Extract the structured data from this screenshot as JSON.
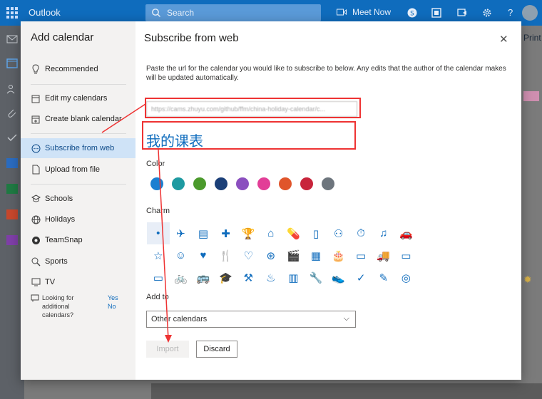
{
  "app": {
    "title": "Outlook",
    "search_placeholder": "Search",
    "meet_now": "Meet Now",
    "accent": "#0f6cbd"
  },
  "background": {
    "print_label": "Print"
  },
  "dialog": {
    "left_title": "Add calendar",
    "nav_items": [
      {
        "label": "Recommended",
        "icon": "lightbulb-icon"
      },
      {
        "label": "Edit my calendars",
        "icon": "edit-calendar-icon"
      },
      {
        "label": "Create blank calendar",
        "icon": "calendar-add-icon"
      },
      {
        "label": "Subscribe from web",
        "icon": "web-subscribe-icon",
        "active": true
      },
      {
        "label": "Upload from file",
        "icon": "upload-file-icon"
      },
      {
        "label": "Schools",
        "icon": "school-icon"
      },
      {
        "label": "Holidays",
        "icon": "globe-icon"
      },
      {
        "label": "TeamSnap",
        "icon": "teamsnap-icon"
      },
      {
        "label": "Sports",
        "icon": "sports-icon"
      },
      {
        "label": "TV",
        "icon": "tv-icon"
      }
    ],
    "looking_for": "Looking for additional calendars?",
    "yes": "Yes",
    "no": "No",
    "right_title": "Subscribe from web",
    "description": "Paste the url for the calendar you would like to subscribe to below. Any edits that the author of the calendar makes will be updated automatically.",
    "url_value": "https://cams.zhuyu.com/github/ffm/china-holiday-calendar/c...",
    "calendar_name": "我的课表",
    "color_label": "Color",
    "colors": [
      "#1a7fd1",
      "#1e9aa1",
      "#4b9a2c",
      "#1b3f78",
      "#8b4fbf",
      "#e23e97",
      "#e0552b",
      "#c8243b",
      "#6d757d"
    ],
    "charm_label": "Charm",
    "charms": [
      "•",
      "✈",
      "▤",
      "✚",
      "🏆",
      "⌂",
      "💊",
      "▯",
      "⚇",
      "⏱",
      "♫",
      "🚗",
      "☆",
      "☺",
      "♥",
      "🍴",
      "♡",
      "⊛",
      "🎬",
      "▦",
      "🎂",
      "▭",
      "🚚",
      "▭",
      "▭",
      "🚲",
      "🚌",
      "🎓",
      "⚒",
      "♨",
      "▥",
      "🔧",
      "👟",
      "✓",
      "✎",
      "◎"
    ],
    "add_to_label": "Add to",
    "add_to_value": "Other calendars",
    "import_label": "Import",
    "discard_label": "Discard"
  }
}
